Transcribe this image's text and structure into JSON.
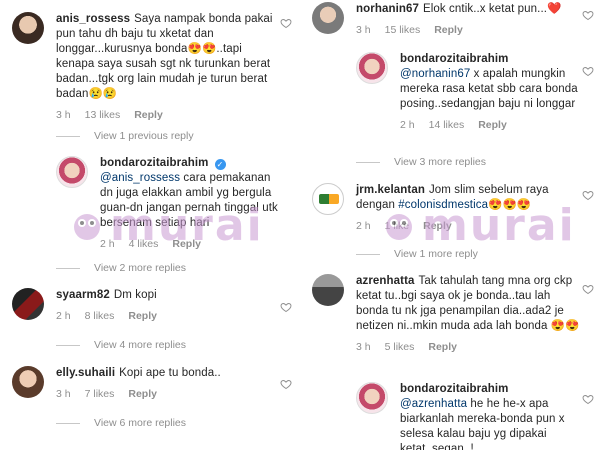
{
  "left": {
    "c1": {
      "user": "anis_rossess",
      "text": "Saya nampak bonda pakai pun tahu dh baju tu xketat dan longgar...kurusnya bonda😍😍..tapi kenapa saya susah sgt nk turunkan berat badan...tgk org lain mudah je turun berat badan😢😢",
      "time": "3 h",
      "likes": "13 likes",
      "reply": "Reply"
    },
    "v1": "View 1 previous reply",
    "c2": {
      "user": "bondarozitaibrahim",
      "mention": "@anis_rossess",
      "text": " cara pemakanan dn juga elakkan ambil yg bergula guan-dn jangan pernah tinggal utk bersenam setiap hari",
      "time": "2 h",
      "likes": "4 likes",
      "reply": "Reply"
    },
    "v2": "View 2 more replies",
    "c3": {
      "user": "syaarm82",
      "text": "Dm kopi",
      "time": "2 h",
      "likes": "8 likes",
      "reply": "Reply"
    },
    "v3": "View 4 more replies",
    "c4": {
      "user": "elly.suhaili",
      "text": "Kopi ape tu bonda..",
      "time": "3 h",
      "likes": "7 likes",
      "reply": "Reply"
    },
    "v4": "View 6 more replies"
  },
  "right": {
    "c1": {
      "user": "norhanin67",
      "text": "Elok cntik..x ketat pun...",
      "heart": "❤️",
      "time": "3 h",
      "likes": "15 likes",
      "reply": "Reply"
    },
    "c2": {
      "user": "bondarozitaibrahim",
      "mention": "@norhanin67",
      "text": " x apalah mungkin mereka rasa ketat sbb cara bonda posing..sedangjan baju ni longgar",
      "time": "2 h",
      "likes": "14 likes",
      "reply": "Reply"
    },
    "v1": "View 3 more replies",
    "c3": {
      "user": "jrm.kelantan",
      "text": "Jom slim sebelum raya dengan ",
      "hashtag": "#colonisdmestica",
      "emoji": "😍😍😍",
      "time": "2 h",
      "likes": "1 like",
      "reply": "Reply"
    },
    "v2": "View 1 more reply",
    "c4": {
      "user": "azrenhatta",
      "text": "Tak tahulah tang mna org ckp ketat tu..bgi saya ok je bonda..tau lah bonda tu nk jga penampilan dia..ada2 je netizen ni..mkin muda ada lah bonda 😍😍",
      "time": "3 h",
      "likes": "5 likes",
      "reply": "Reply"
    },
    "c5": {
      "user": "bondarozitaibrahim",
      "mention": "@azrenhatta",
      "text": " he he he-x apa biarkanlah mereka-bonda pun x selesa kalau baju yg dipakai ketat..segan..!"
    }
  },
  "watermark": "murai",
  "colors": {
    "link": "#00376b",
    "meta": "#8e8e8e",
    "verified": "#3897f0",
    "watermark": "#c99ad2"
  }
}
